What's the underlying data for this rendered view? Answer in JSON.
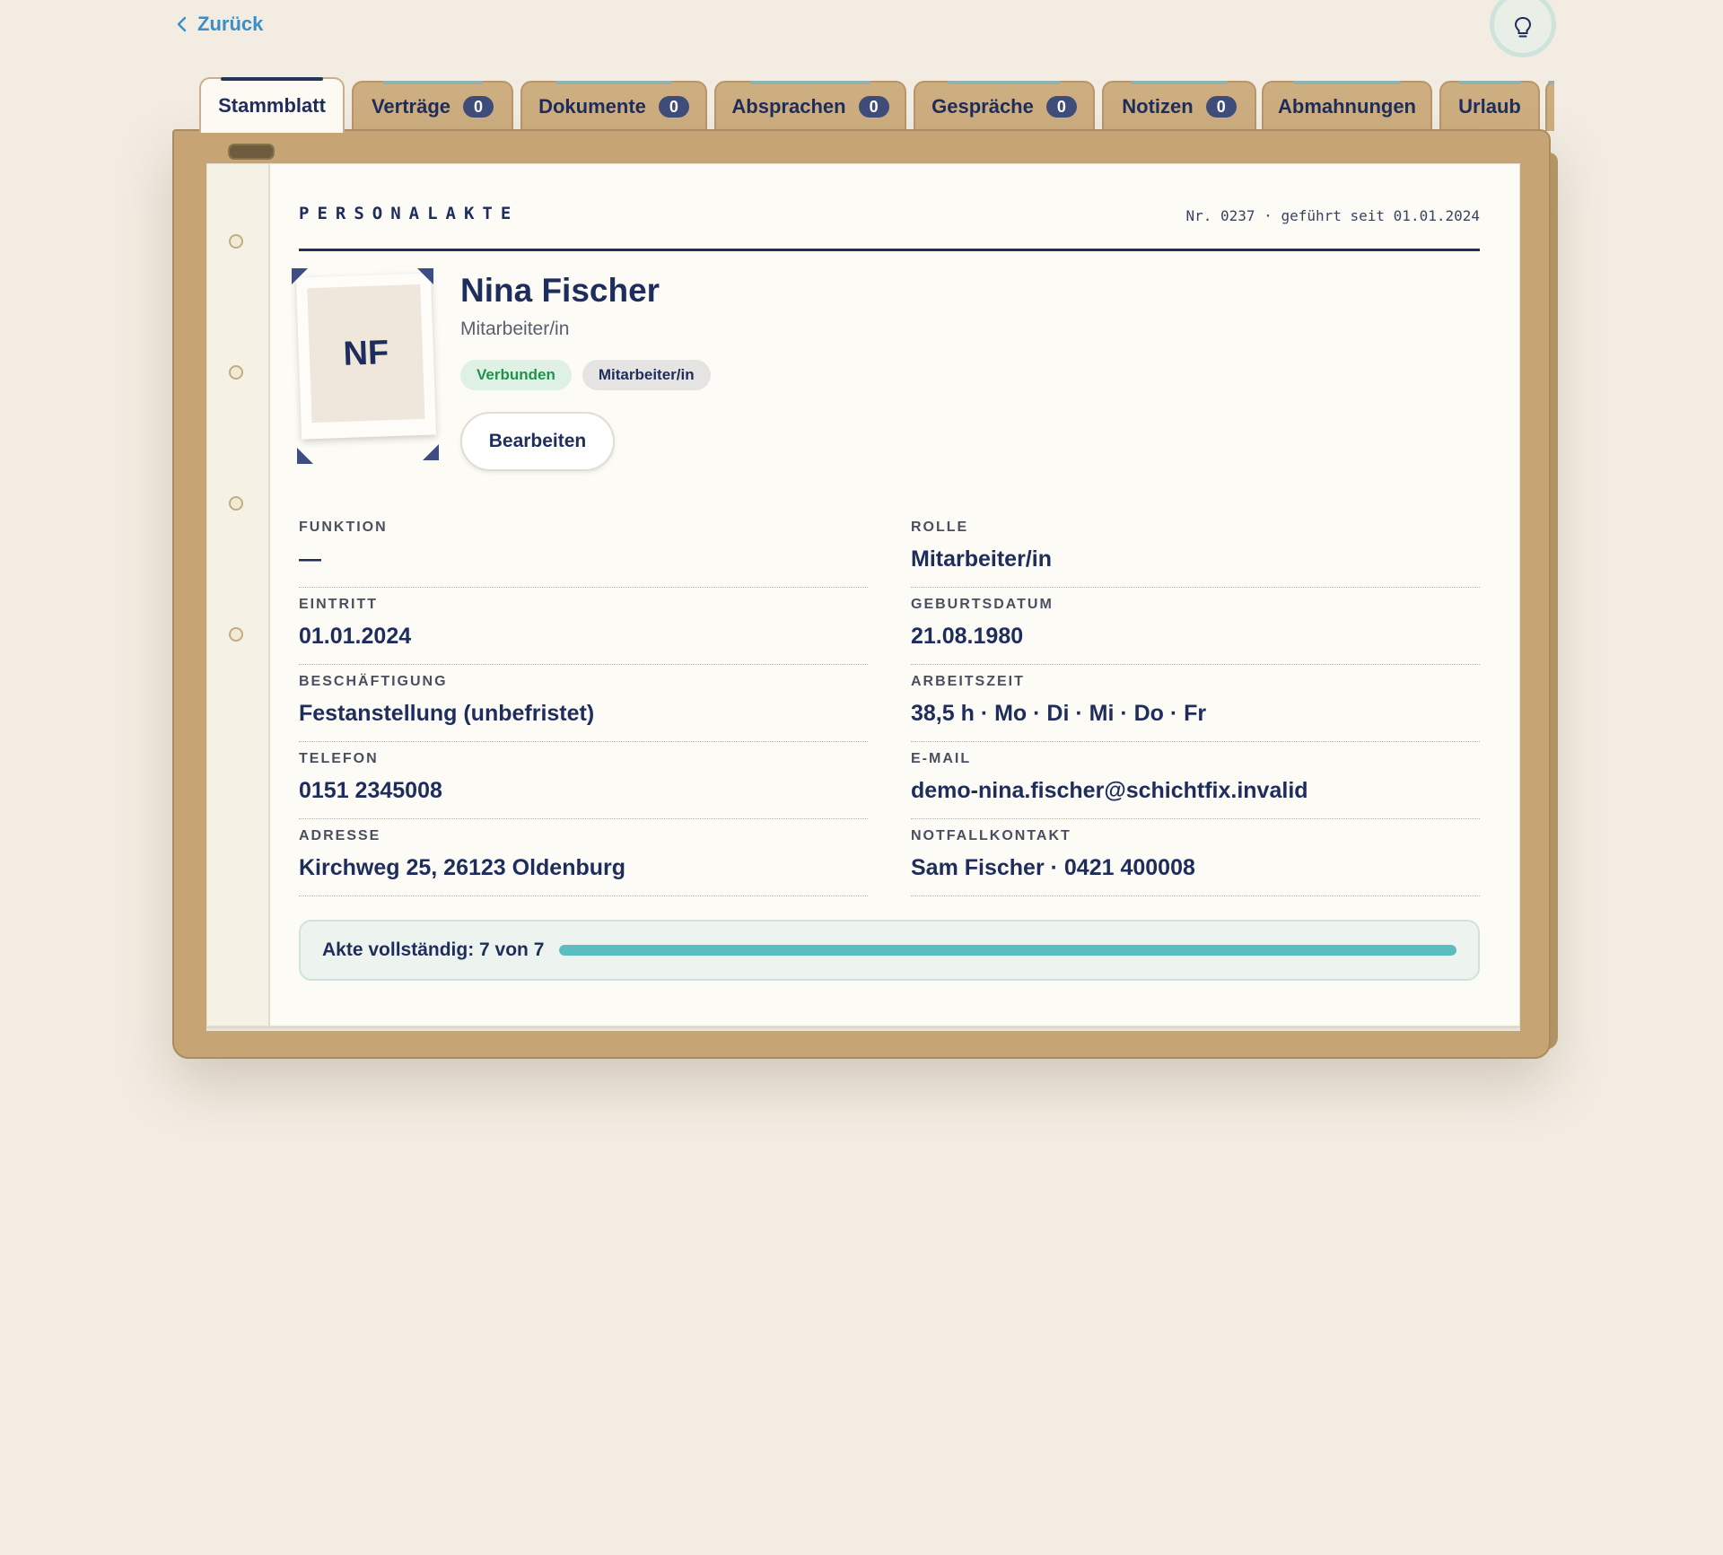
{
  "nav": {
    "back_label": "Zurück"
  },
  "tabs": [
    {
      "label": "Stammblatt",
      "badge": null,
      "active": true
    },
    {
      "label": "Verträge",
      "badge": "0"
    },
    {
      "label": "Dokumente",
      "badge": "0"
    },
    {
      "label": "Absprachen",
      "badge": "0"
    },
    {
      "label": "Gespräche",
      "badge": "0"
    },
    {
      "label": "Notizen",
      "badge": "0"
    },
    {
      "label": "Abmahnungen",
      "badge": null
    },
    {
      "label": "Urlaub",
      "badge": null
    }
  ],
  "document": {
    "title": "PERSONALAKTE",
    "meta": "Nr. 0237 · geführt seit 01.01.2024"
  },
  "person": {
    "initials": "NF",
    "name": "Nina Fischer",
    "role": "Mitarbeiter/in",
    "chips": [
      "Verbunden",
      "Mitarbeiter/in"
    ],
    "edit_label": "Bearbeiten"
  },
  "fields": [
    {
      "label": "FUNKTION",
      "value": "—"
    },
    {
      "label": "ROLLE",
      "value": "Mitarbeiter/in"
    },
    {
      "label": "EINTRITT",
      "value": "01.01.2024"
    },
    {
      "label": "GEBURTSDATUM",
      "value": "21.08.1980"
    },
    {
      "label": "BESCHÄFTIGUNG",
      "value": "Festanstellung (unbefristet)"
    },
    {
      "label": "ARBEITSZEIT",
      "value": "38,5 h · Mo · Di · Mi · Do · Fr"
    },
    {
      "label": "TELEFON",
      "value": "0151 2345008"
    },
    {
      "label": "E-MAIL",
      "value": "demo-nina.fischer@schichtfix.invalid"
    },
    {
      "label": "ADRESSE",
      "value": "Kirchweg 25, 26123 Oldenburg"
    },
    {
      "label": "NOTFALLKONTAKT",
      "value": "Sam Fischer · 0421 400008"
    }
  ],
  "completeness": {
    "label": "Akte vollständig: 7 von 7",
    "fraction": 1.0
  },
  "colors": {
    "accent": "#1e2d5c",
    "link": "#3c8fc6",
    "folder": "#c6a473",
    "progress": "#5bbdc0",
    "status_green": "#22924a"
  },
  "icons": {
    "back": "chevron-left-icon",
    "hint": "lightbulb-icon"
  }
}
